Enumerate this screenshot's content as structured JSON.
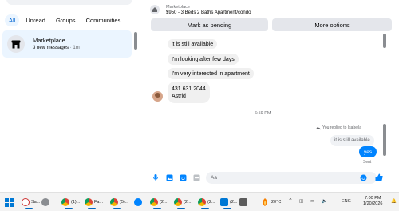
{
  "filters": [
    "All",
    "Unread",
    "Groups",
    "Communities"
  ],
  "conversation": {
    "title": "Marketplace",
    "subtitle": "3 new messages",
    "time": "· 1m"
  },
  "listing": {
    "source": "Marketplace",
    "title": "$950 - 3 Beds 2 Baths Apartment/condo"
  },
  "actions": {
    "mark_pending": "Mark as pending",
    "more_options": "More options"
  },
  "messages": {
    "m1": "it is still available",
    "m2": "I'm looking after few days",
    "m3": "I'm very interested in apartment",
    "m4_line1": "431 631 2044",
    "m4_line2": "Astrid"
  },
  "timestamp": "6:59 PM",
  "reply": {
    "note": "You replied to Isabella",
    "quoted": "it is still available",
    "text": "yes",
    "status": "Sent"
  },
  "composer": {
    "placeholder": "Aa"
  },
  "taskbar": {
    "items": [
      "Sa...",
      "(1)...",
      "Fa...",
      "(5)...",
      "(2...",
      "(2...",
      "(2...",
      "(2..."
    ],
    "temperature": "20°C",
    "language": "ENG",
    "time": "7:00 PM",
    "date": "1/20/2026"
  },
  "colors": {
    "accent": "#0084ff",
    "active_filter_bg": "#ebf5ff",
    "button_bg": "#e4e6eb"
  }
}
